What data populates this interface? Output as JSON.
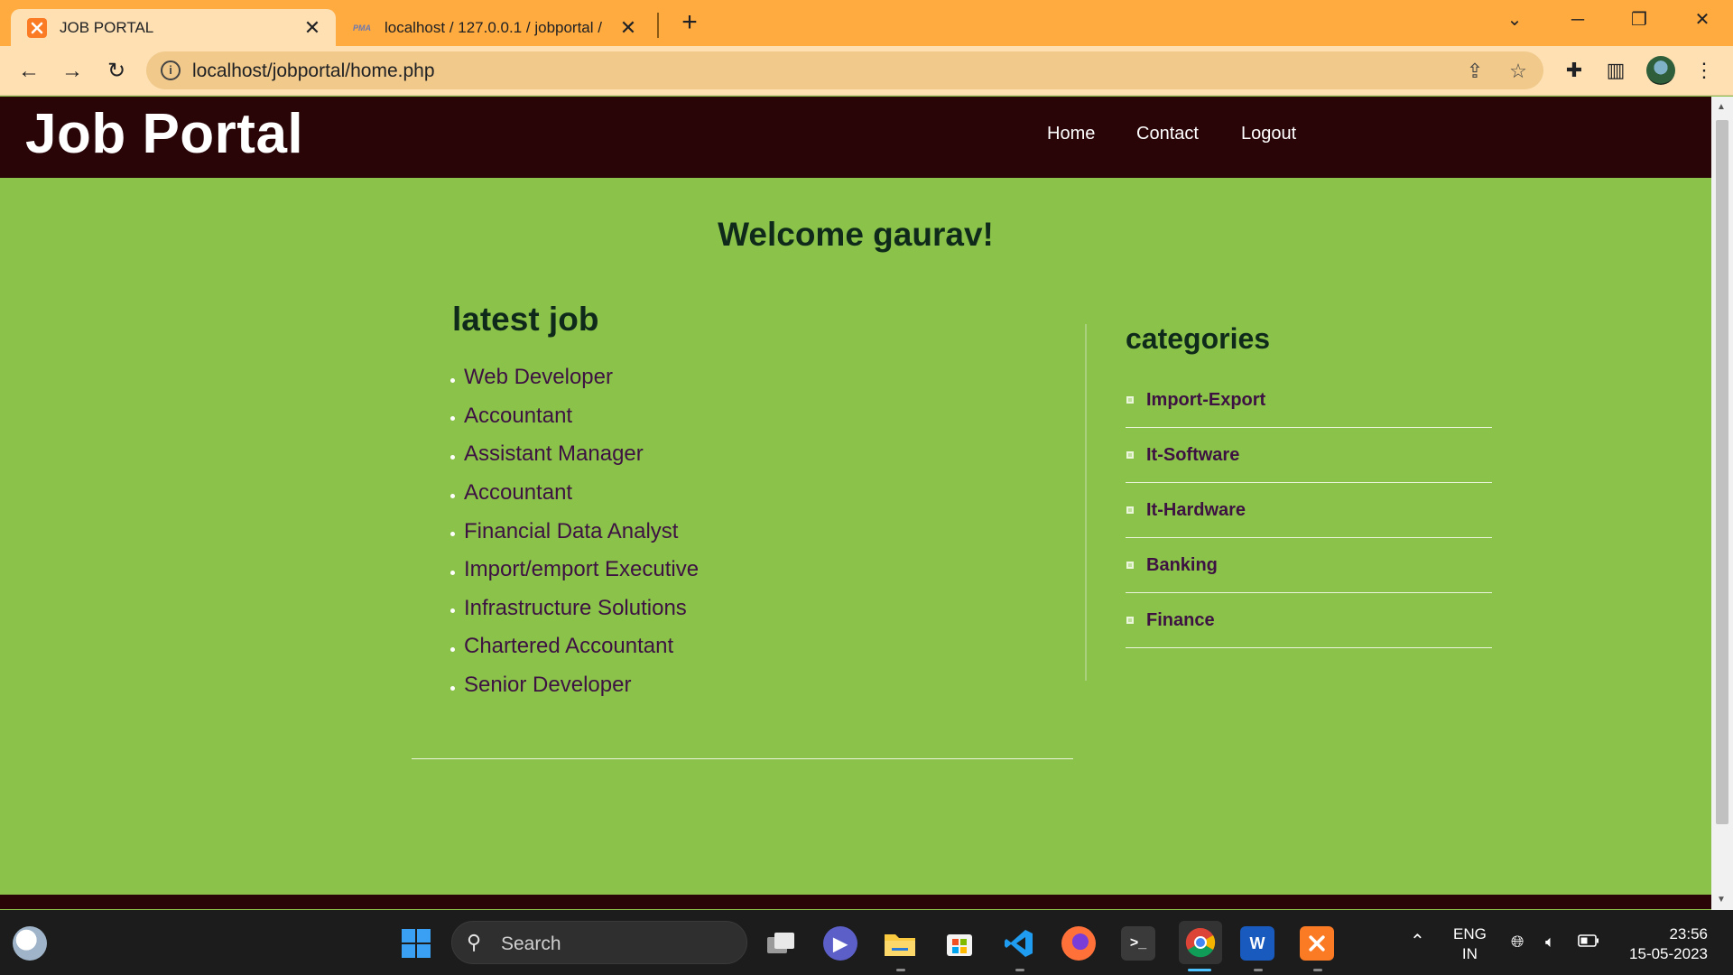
{
  "browser": {
    "tabs": [
      {
        "title": "JOB PORTAL",
        "active": true,
        "favicon": "xampp-icon"
      },
      {
        "title": "localhost / 127.0.0.1 / jobportal / ",
        "active": false,
        "favicon": "phpmyadmin-icon",
        "favicon_text": "PMA"
      }
    ],
    "url": "localhost/jobportal/home.php"
  },
  "site": {
    "logo": "Job Portal",
    "nav": [
      "Home",
      "Contact",
      "Logout"
    ],
    "welcome": "Welcome gaurav!",
    "latest_title": "latest job",
    "jobs": [
      "Web Developer",
      "Accountant",
      "Assistant Manager",
      "Accountant",
      "Financial Data Analyst",
      "Import/emport Executive",
      "Infrastructure Solutions",
      "Chartered Accountant",
      "Senior Developer"
    ],
    "categories_title": "categories",
    "categories": [
      "Import-Export",
      "It-Software",
      "It-Hardware",
      "Banking",
      "Finance"
    ]
  },
  "taskbar": {
    "search_placeholder": "Search",
    "language": "ENG",
    "region": "IN",
    "time": "23:56",
    "date": "15-05-2023"
  },
  "colors": {
    "tabbar": "#ffab40",
    "header": "#290508",
    "page_bg": "#8bc34a",
    "link_text": "#3d1242"
  }
}
